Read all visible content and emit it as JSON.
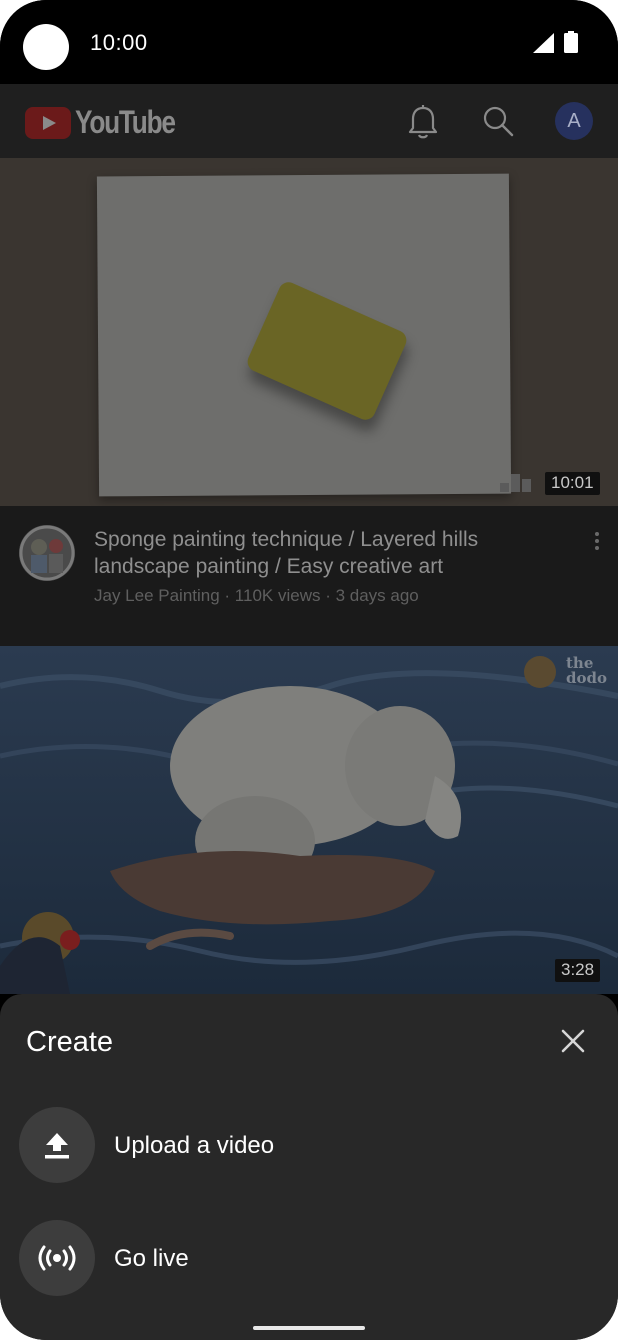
{
  "status_bar": {
    "time": "10:00"
  },
  "app_bar": {
    "logo_text": "YouTube",
    "avatar_letter": "A",
    "icons": [
      "notification-bell-icon",
      "search-icon"
    ]
  },
  "feed": {
    "videos": [
      {
        "duration": "10:01",
        "title": "Sponge painting technique / Layered hills landscape painting / Easy creative art",
        "subtitle": "Jay Lee Painting · 110K views · 3 days ago"
      },
      {
        "duration": "3:28",
        "watermark": "the dodo"
      }
    ]
  },
  "create_sheet": {
    "title": "Create",
    "items": [
      {
        "label": "Upload a video",
        "icon": "upload-icon"
      },
      {
        "label": "Go live",
        "icon": "live-broadcast-icon"
      }
    ]
  },
  "colors": {
    "sheet_background": "#282828",
    "scrim_dimmed_brand_red": "#6b1a1a",
    "avatar_background": "#26315e"
  }
}
